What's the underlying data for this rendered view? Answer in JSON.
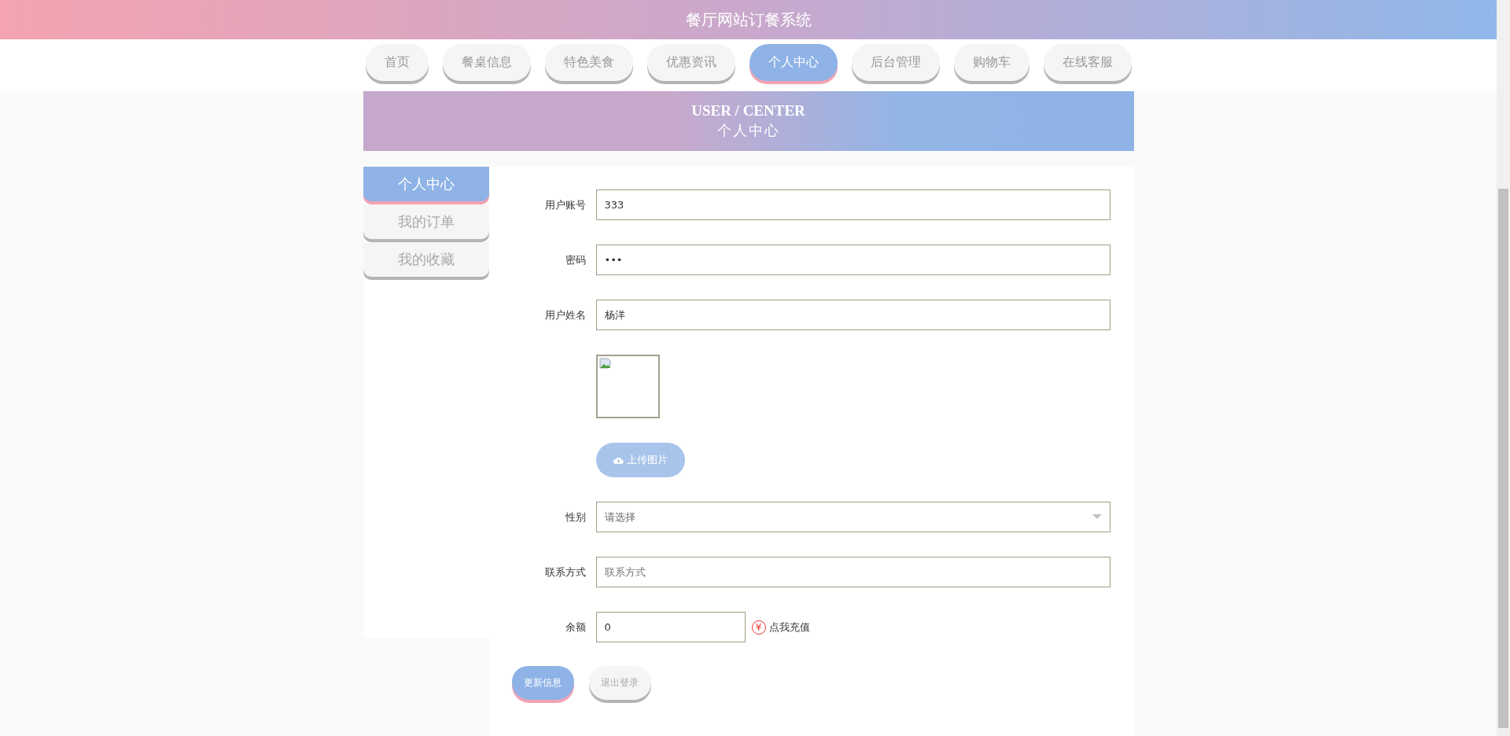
{
  "header": {
    "title": "餐厅网站订餐系统"
  },
  "nav": [
    {
      "label": "首页",
      "selected": false
    },
    {
      "label": "餐桌信息",
      "selected": false
    },
    {
      "label": "特色美食",
      "selected": false
    },
    {
      "label": "优惠资讯",
      "selected": false
    },
    {
      "label": "个人中心",
      "selected": true
    },
    {
      "label": "后台管理",
      "selected": false
    },
    {
      "label": "购物车",
      "selected": false
    },
    {
      "label": "在线客服",
      "selected": false
    }
  ],
  "banner": {
    "title": "USER / CENTER",
    "subtitle": "个人中心"
  },
  "sidebar": [
    {
      "label": "个人中心",
      "selected": true
    },
    {
      "label": "我的订单",
      "selected": false
    },
    {
      "label": "我的收藏",
      "selected": false
    }
  ],
  "form": {
    "fields": [
      {
        "kind": "text",
        "label": "用户账号",
        "value": "333"
      },
      {
        "kind": "text",
        "label": "密码",
        "value": "•••"
      },
      {
        "kind": "text",
        "label": "用户姓名",
        "value": "杨洋"
      },
      {
        "kind": "image",
        "upload_label": "上传图片"
      },
      {
        "kind": "select",
        "label": "性别",
        "placeholder": "请选择"
      },
      {
        "kind": "text",
        "label": "联系方式",
        "placeholder": "联系方式"
      },
      {
        "kind": "balance",
        "label": "余额",
        "value": "0",
        "link_icon": "¥",
        "link": "点我充值"
      }
    ],
    "buttons": [
      {
        "kind": "primary",
        "label": "更新信息"
      },
      {
        "kind": "secondary",
        "label": "退出登录"
      }
    ]
  }
}
